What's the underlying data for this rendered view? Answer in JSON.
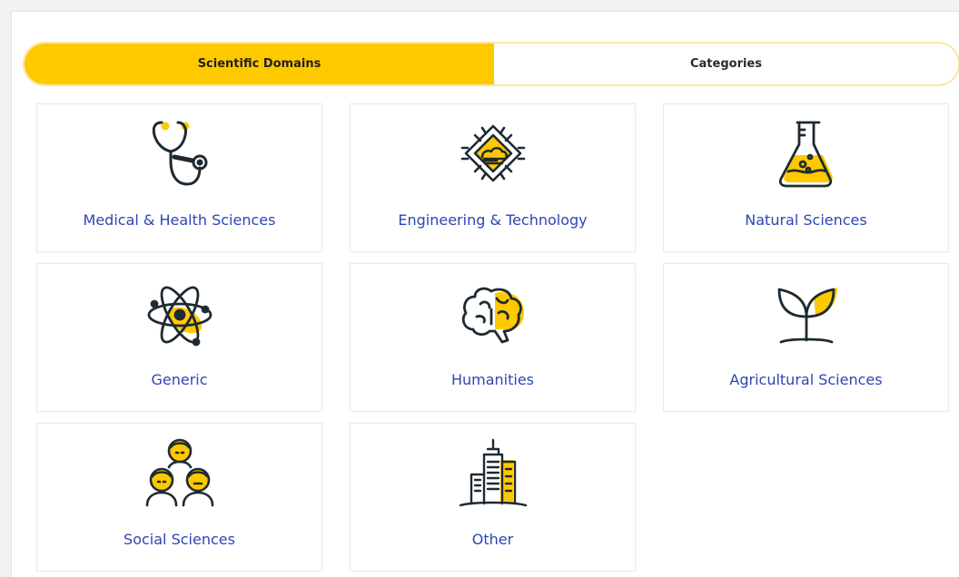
{
  "tabs": [
    {
      "label": "Scientific Domains",
      "active": true
    },
    {
      "label": "Categories",
      "active": false
    }
  ],
  "domains": [
    {
      "label": "Medical & Health Sciences",
      "icon": "stethoscope-icon"
    },
    {
      "label": "Engineering & Technology",
      "icon": "chip-icon"
    },
    {
      "label": "Natural Sciences",
      "icon": "flask-icon"
    },
    {
      "label": "Generic",
      "icon": "atom-icon"
    },
    {
      "label": "Humanities",
      "icon": "brain-icon"
    },
    {
      "label": "Agricultural Sciences",
      "icon": "sprout-icon"
    },
    {
      "label": "Social Sciences",
      "icon": "people-icon"
    },
    {
      "label": "Other",
      "icon": "buildings-icon"
    }
  ],
  "colors": {
    "accent": "#ffc900",
    "accent_light": "#fbe7a0",
    "label": "#2d45b4",
    "icon_stroke": "#1e2a32"
  }
}
